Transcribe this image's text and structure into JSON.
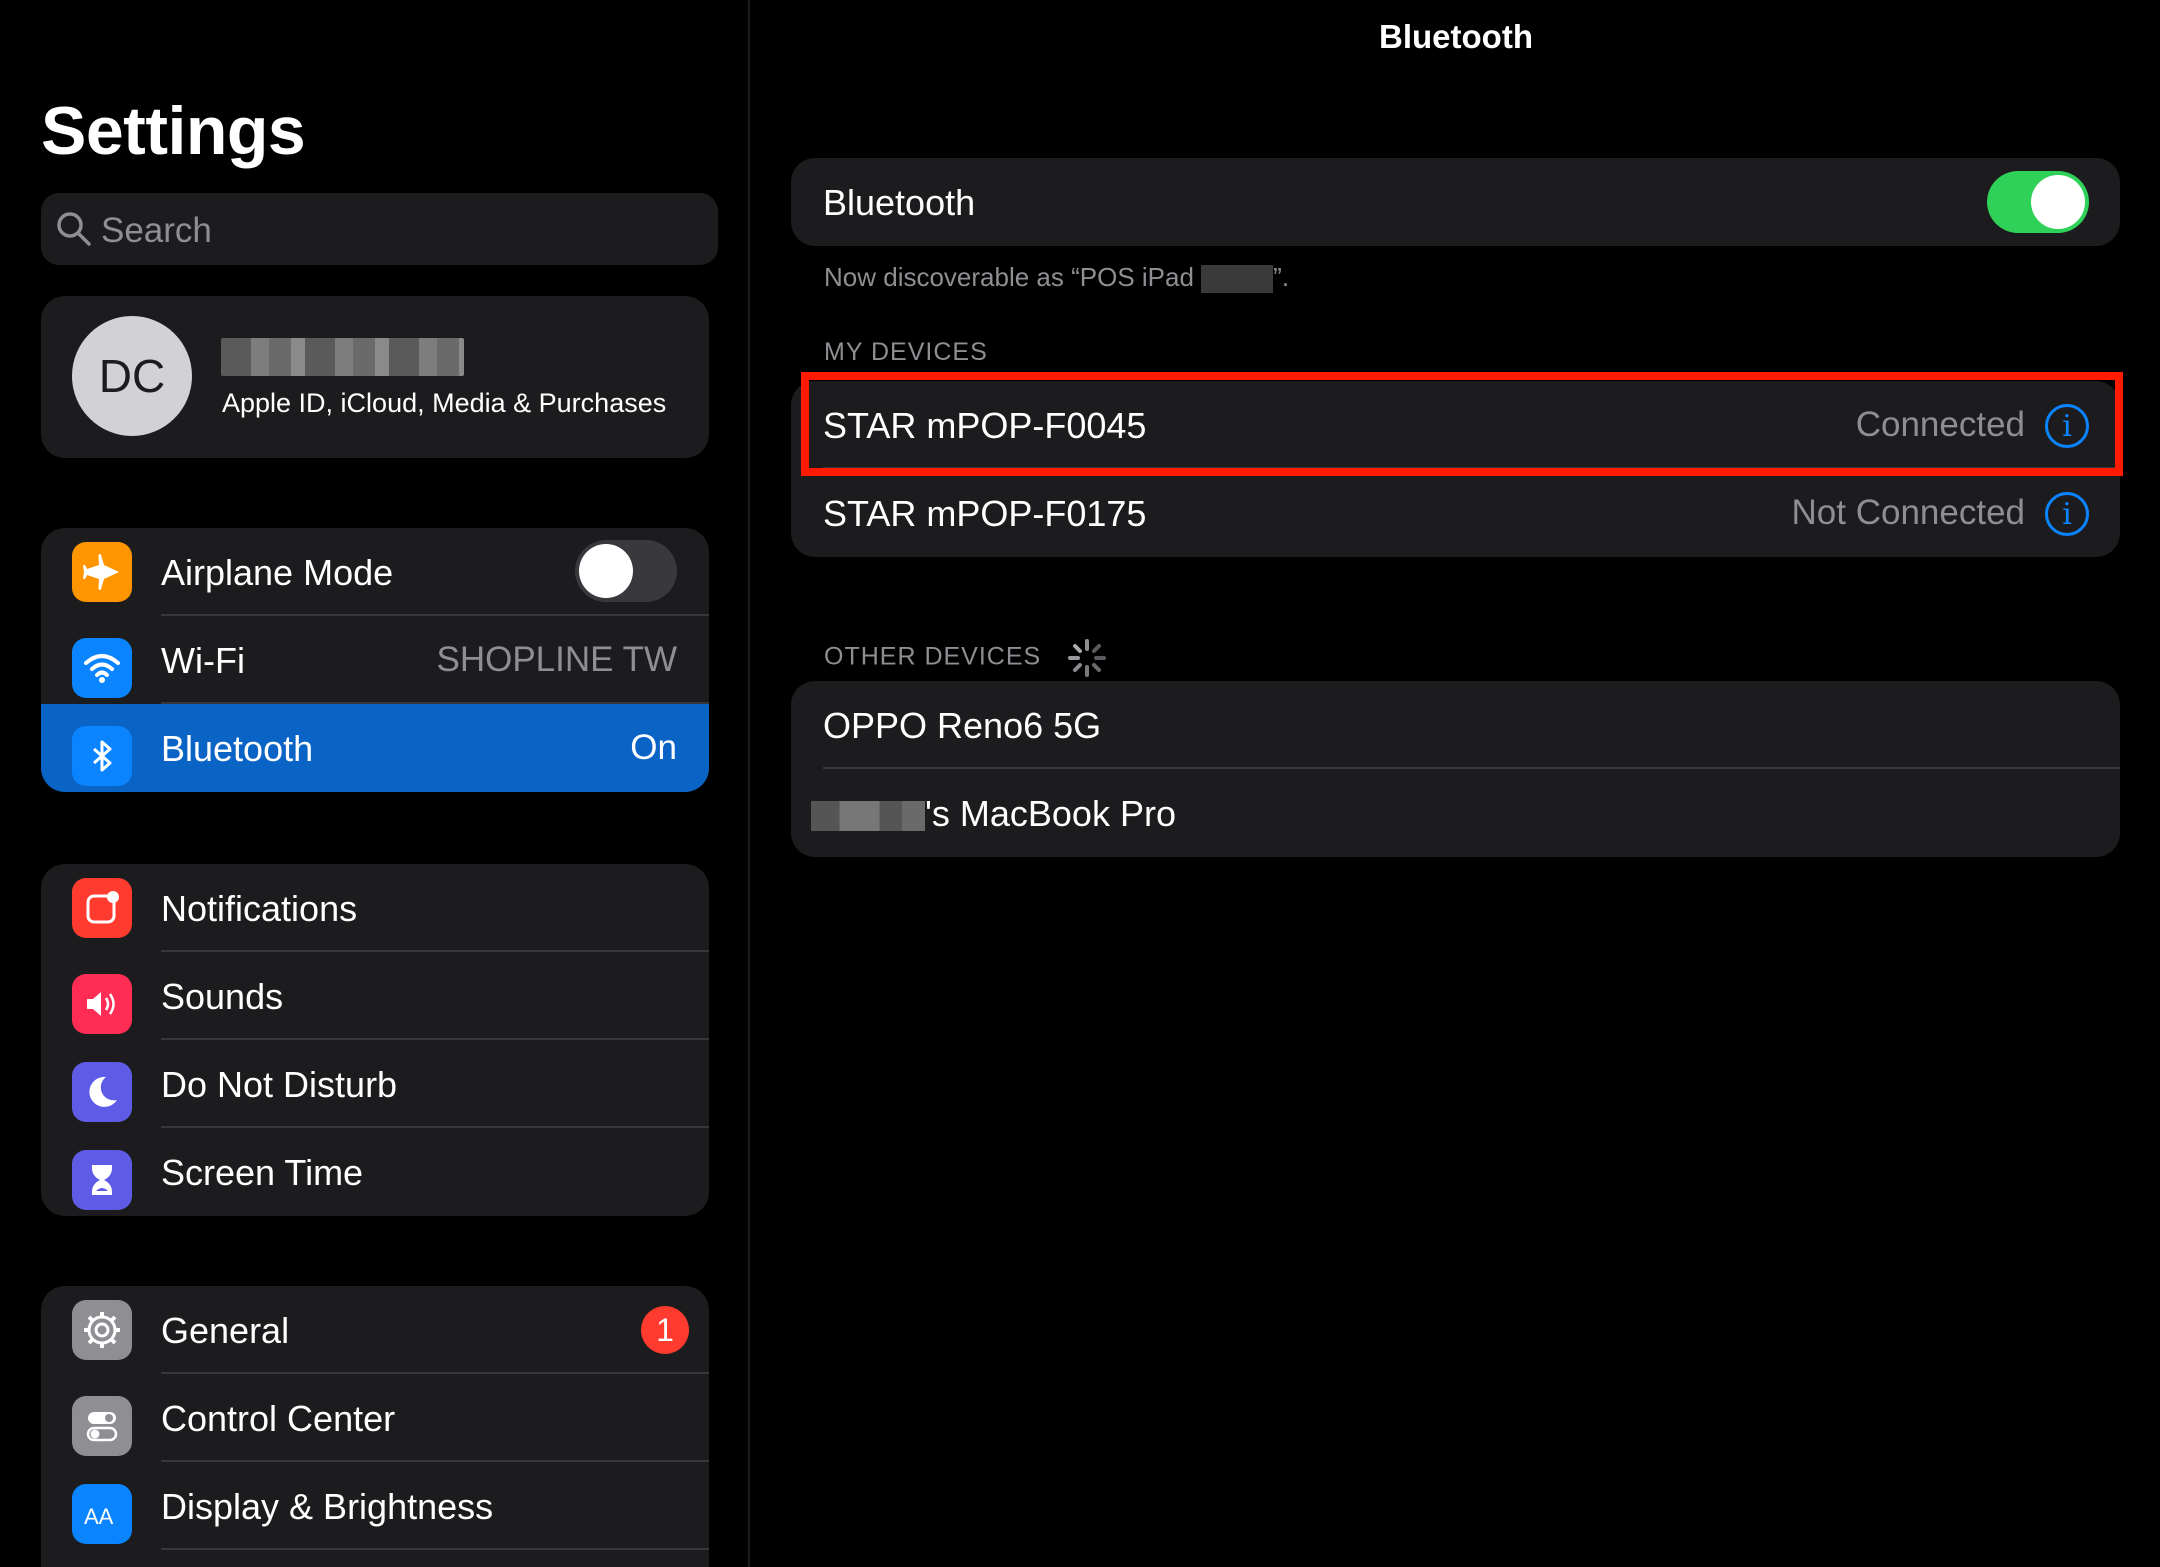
{
  "sidebar": {
    "title": "Settings",
    "search_placeholder": "Search",
    "profile": {
      "initials": "DC",
      "subtitle": "Apple ID, iCloud, Media & Purchases"
    },
    "group1": [
      {
        "label": "Airplane Mode",
        "icon": "airplane-icon",
        "color": "#ff9500"
      },
      {
        "label": "Wi-Fi",
        "value": "SHOPLINE TW",
        "icon": "wifi-icon",
        "color": "#0a84ff"
      },
      {
        "label": "Bluetooth",
        "value": "On",
        "icon": "bluetooth-icon",
        "color": "#0a84ff"
      }
    ],
    "group2": [
      {
        "label": "Notifications",
        "icon": "notifications-icon",
        "color": "#ff3b30"
      },
      {
        "label": "Sounds",
        "icon": "sounds-icon",
        "color": "#ff2d55"
      },
      {
        "label": "Do Not Disturb",
        "icon": "moon-icon",
        "color": "#5e5ce6"
      },
      {
        "label": "Screen Time",
        "icon": "hourglass-icon",
        "color": "#5e5ce6"
      }
    ],
    "group3": [
      {
        "label": "General",
        "badge": "1",
        "icon": "gear-icon",
        "color": "#8e8e93"
      },
      {
        "label": "Control Center",
        "icon": "toggles-icon",
        "color": "#8e8e93"
      },
      {
        "label": "Display & Brightness",
        "icon": "text-size-icon",
        "color": "#0a84ff"
      }
    ]
  },
  "detail": {
    "nav_title": "Bluetooth",
    "bluetooth_label": "Bluetooth",
    "bluetooth_on": true,
    "discoverable_prefix": "Now discoverable as “POS iPad ",
    "discoverable_suffix": "”.",
    "my_devices_header": "MY DEVICES",
    "my_devices": [
      {
        "name": "STAR mPOP-F0045",
        "status": "Connected"
      },
      {
        "name": "STAR mPOP-F0175",
        "status": "Not Connected"
      }
    ],
    "other_devices_header": "OTHER DEVICES",
    "other_devices": [
      {
        "name": "OPPO Reno6 5G"
      },
      {
        "name": "'s MacBook Pro"
      }
    ]
  },
  "colors": {
    "accent": "#0a84ff",
    "selected_row": "#0a64c6",
    "toggle_on": "#30d158",
    "highlight_box": "#ff1a00"
  }
}
